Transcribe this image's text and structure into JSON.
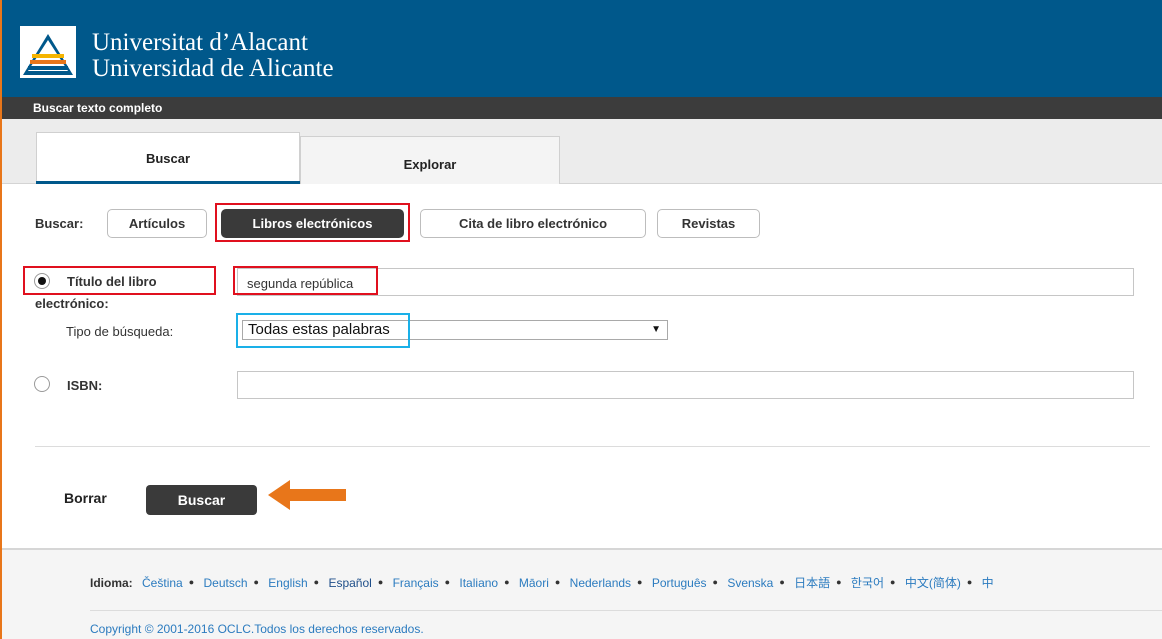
{
  "header": {
    "university_line1": "Universitat d’Alacant",
    "university_line2": "Universidad de Alicante",
    "brand_color": "#00588b"
  },
  "topbar": {
    "title": "Buscar texto completo"
  },
  "tabs": [
    {
      "label": "Buscar",
      "active": true
    },
    {
      "label": "Explorar",
      "active": false
    }
  ],
  "search_type": {
    "label": "Buscar:",
    "options": [
      {
        "label": "Artículos",
        "selected": false
      },
      {
        "label": "Libros electrónicos",
        "selected": true
      },
      {
        "label": "Cita de libro electrónico",
        "selected": false
      },
      {
        "label": "Revistas",
        "selected": false
      }
    ]
  },
  "form": {
    "title_field": {
      "label_line1": "Título del libro",
      "label_line2": "electrónico:",
      "value": "segunda república",
      "selected": true
    },
    "search_mode": {
      "label": "Tipo de búsqueda:",
      "value": "Todas estas palabras"
    },
    "isbn_field": {
      "label": "ISBN:",
      "value": "",
      "selected": false
    }
  },
  "actions": {
    "clear_label": "Borrar",
    "search_label": "Buscar",
    "arrow_color": "#e8761a"
  },
  "footer": {
    "language_label": "Idioma:",
    "languages": [
      "Čeština",
      "Deutsch",
      "English",
      "Español",
      "Français",
      "Italiano",
      "Māori",
      "Nederlands",
      "Português",
      "Svenska",
      "日本語",
      "한국어",
      "中文(简体)",
      "中"
    ],
    "current_language": "Español",
    "copyright": "Copyright © 2001-2016 OCLC.Todos los derechos reservados."
  },
  "highlight_colors": {
    "red": "#e0101e",
    "blue": "#1ab0e8"
  }
}
